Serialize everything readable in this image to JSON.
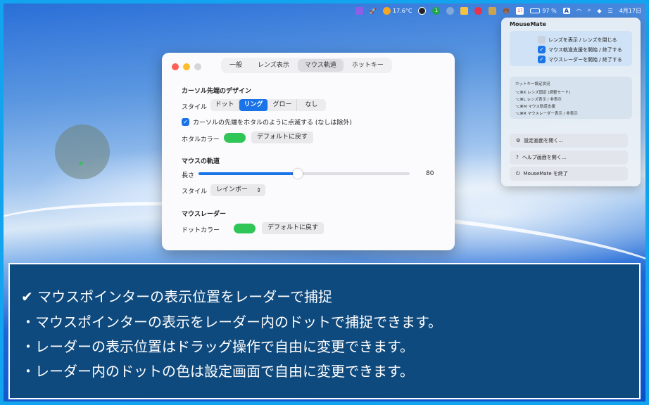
{
  "menubar": {
    "weather": "17.6°C",
    "notif_count": "1",
    "calendar_day": "17",
    "battery": "97 %",
    "input_source": "A",
    "date": "4月17日"
  },
  "settings": {
    "tabs": [
      "一般",
      "レンズ表示",
      "マウス軌道",
      "ホットキー"
    ],
    "active_tab": 2,
    "cursor_section": {
      "title": "カーソル先端のデザイン",
      "style_label": "スタイル",
      "style_options": [
        "ドット",
        "リング",
        "グロー",
        "なし"
      ],
      "style_selected": 1,
      "blink_label": "カーソルの先端をホタルのように点滅する (なしは除外)",
      "firefly_color_label": "ホタルカラー",
      "reset_label": "デフォルトに戻す",
      "color": "#2fc557"
    },
    "trail_section": {
      "title": "マウスの軌道",
      "length_label": "長さ",
      "length_value": "80",
      "length_fraction": 0.47,
      "style_label": "スタイル",
      "style_value": "レインボー"
    },
    "radar_section": {
      "title": "マウスレーダー",
      "dot_color_label": "ドットカラー",
      "reset_label": "デフォルトに戻す",
      "color": "#2fc557"
    }
  },
  "menu": {
    "title": "MouseMate",
    "toggles": [
      {
        "label": "レンズを表示 / レンズを閉じる",
        "checked": false
      },
      {
        "label": "マウス軌道支援を開始 / 終了する",
        "checked": true
      },
      {
        "label": "マウスレーダーを開始 / 終了する",
        "checked": true
      }
    ],
    "hotkey_title": "ホットキー設定状況",
    "hotkeys": [
      "⌥⌘K レンズ固定 (調整モード)",
      "⌥⌘L レンズ表示 / 非表示",
      "⌥⌘M マウス軌道支援",
      "⌥⌘R マウスレーダー表示 / 非表示"
    ],
    "actions": [
      {
        "label": "設定画面を開く...",
        "icon": "gear-icon"
      },
      {
        "label": "ヘルプ画面を開く...",
        "icon": "question-icon"
      },
      {
        "label": "MouseMate を終了",
        "icon": "power-icon"
      }
    ]
  },
  "caption": {
    "headline": "✔ マウスポインターの表示位置をレーダーで捕捉",
    "lines": [
      "・マウスポインターの表示をレーダー内のドットで捕捉できます。",
      "・レーダーの表示位置はドラッグ操作で自由に変更できます。",
      "・レーダー内のドットの色は設定画面で自由に変更できます。"
    ]
  }
}
